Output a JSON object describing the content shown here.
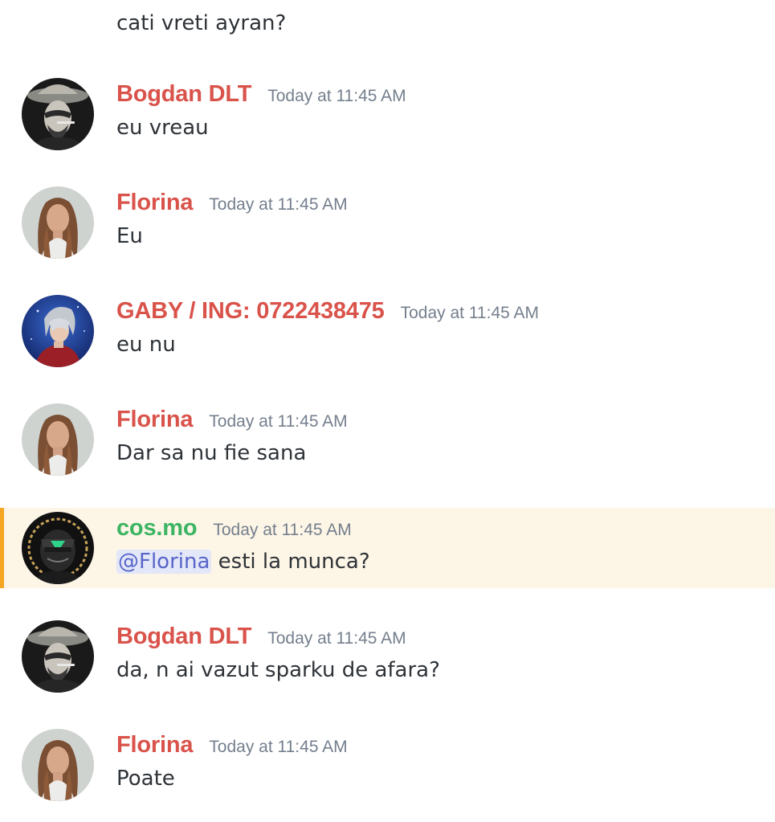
{
  "channel": {
    "previous_message_text": "cati vreti ayran?"
  },
  "colors": {
    "role_red": "#d9534b",
    "role_green": "#3cb563",
    "mention_highlight_bg": "#fdf5e6",
    "mention_bar": "#f5a623",
    "timestamp": "#747f8d"
  },
  "messages": [
    {
      "author": "Bogdan DLT",
      "timestamp": "Today at 11:45 AM",
      "text": "eu vreau",
      "avatar": "bogdan-avatar",
      "name_color": "#d9534b"
    },
    {
      "author": "Florina",
      "timestamp": "Today at 11:45 AM",
      "text": "Eu",
      "avatar": "florina-avatar",
      "name_color": "#d9534b"
    },
    {
      "author": "GABY / ING: 0722438475",
      "timestamp": "Today at 11:45 AM",
      "text": "eu nu",
      "avatar": "gaby-avatar",
      "name_color": "#d9534b"
    },
    {
      "author": "Florina",
      "timestamp": "Today at 11:45 AM",
      "text": "Dar sa nu fie sana",
      "avatar": "florina-avatar",
      "name_color": "#d9534b"
    },
    {
      "author": "cos.mo",
      "timestamp": "Today at 11:45 AM",
      "mention": "@Florina",
      "text": " esti la munca?",
      "avatar": "cosmo-avatar",
      "name_color": "#3cb563",
      "highlighted": true
    },
    {
      "author": "Bogdan DLT",
      "timestamp": "Today at 11:45 AM",
      "text": "da, n ai vazut sparku de afara?",
      "avatar": "bogdan-avatar",
      "name_color": "#d9534b"
    },
    {
      "author": "Florina",
      "timestamp": "Today at 11:45 AM",
      "text": "Poate",
      "avatar": "florina-avatar",
      "name_color": "#d9534b"
    }
  ]
}
